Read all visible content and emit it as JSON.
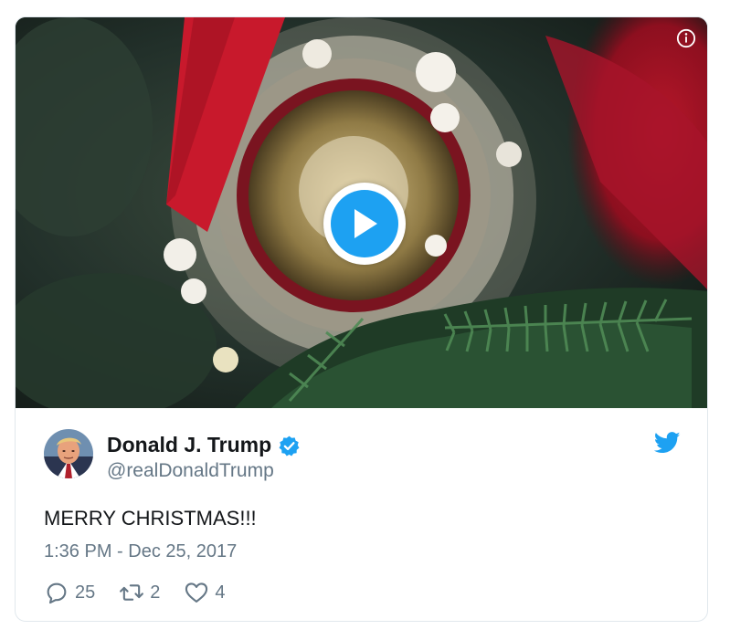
{
  "media": {
    "play_icon": "play-icon",
    "info_icon": "info-icon"
  },
  "author": {
    "name": "Donald J. Trump",
    "handle": "@realDonaldTrump",
    "verified": true
  },
  "tweet": {
    "text": "MERRY CHRISTMAS!!!",
    "timestamp": "1:36 PM - Dec 25, 2017"
  },
  "actions": {
    "replies": "25",
    "retweets": "2",
    "likes": "4"
  },
  "colors": {
    "accent": "#1da1f2",
    "text": "#14171a",
    "secondary_text": "#657786",
    "border": "#e1e8ed"
  }
}
